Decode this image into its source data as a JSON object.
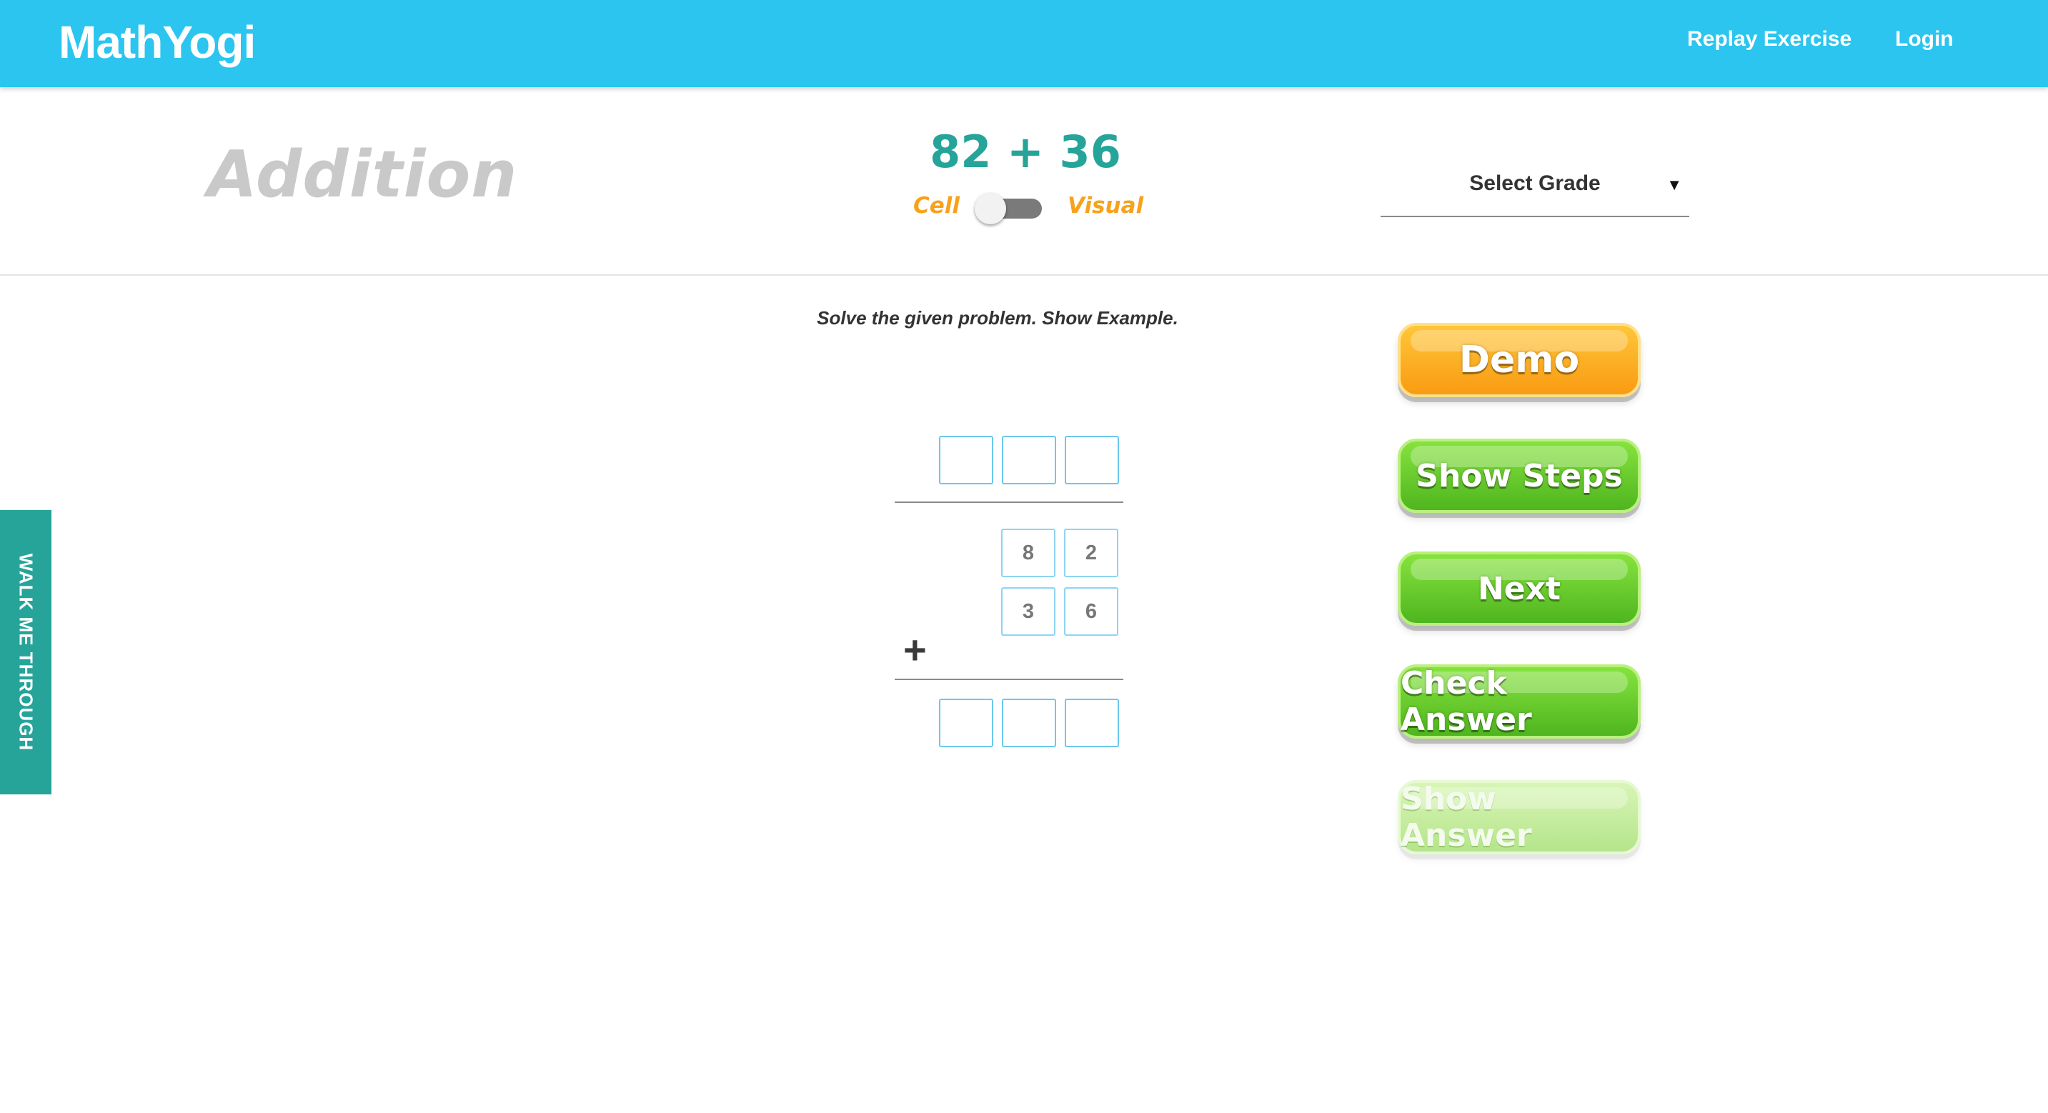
{
  "app": {
    "brand": "MathYogi",
    "nav": {
      "replay": "Replay Exercise",
      "login": "Login"
    }
  },
  "exercise": {
    "topic": "Addition",
    "problem": "82 + 36",
    "mode_toggle": {
      "left_label": "Cell",
      "right_label": "Visual",
      "selected": "Cell"
    },
    "grade_select": {
      "label": "Select Grade",
      "caret": "▼"
    },
    "instruction": "Solve the given problem. Show Example.",
    "operator": "+",
    "addend_1": [
      "8",
      "2"
    ],
    "addend_2": [
      "3",
      "6"
    ],
    "carry_cells": [
      "",
      "",
      ""
    ],
    "answer_cells": [
      "",
      "",
      ""
    ]
  },
  "sidebar_tab": {
    "label": "WALK ME THROUGH"
  },
  "actions": {
    "demo": "Demo",
    "show_steps": "Show Steps",
    "next": "Next",
    "check_answer": "Check Answer",
    "show_answer": "Show Answer",
    "show_answer_enabled": false
  },
  "colors": {
    "header": "#2bc5ef",
    "teal": "#26a49a",
    "orange": "#f7a21b",
    "green_button": "#5cc226",
    "cell_border": "#6ac8ee"
  }
}
